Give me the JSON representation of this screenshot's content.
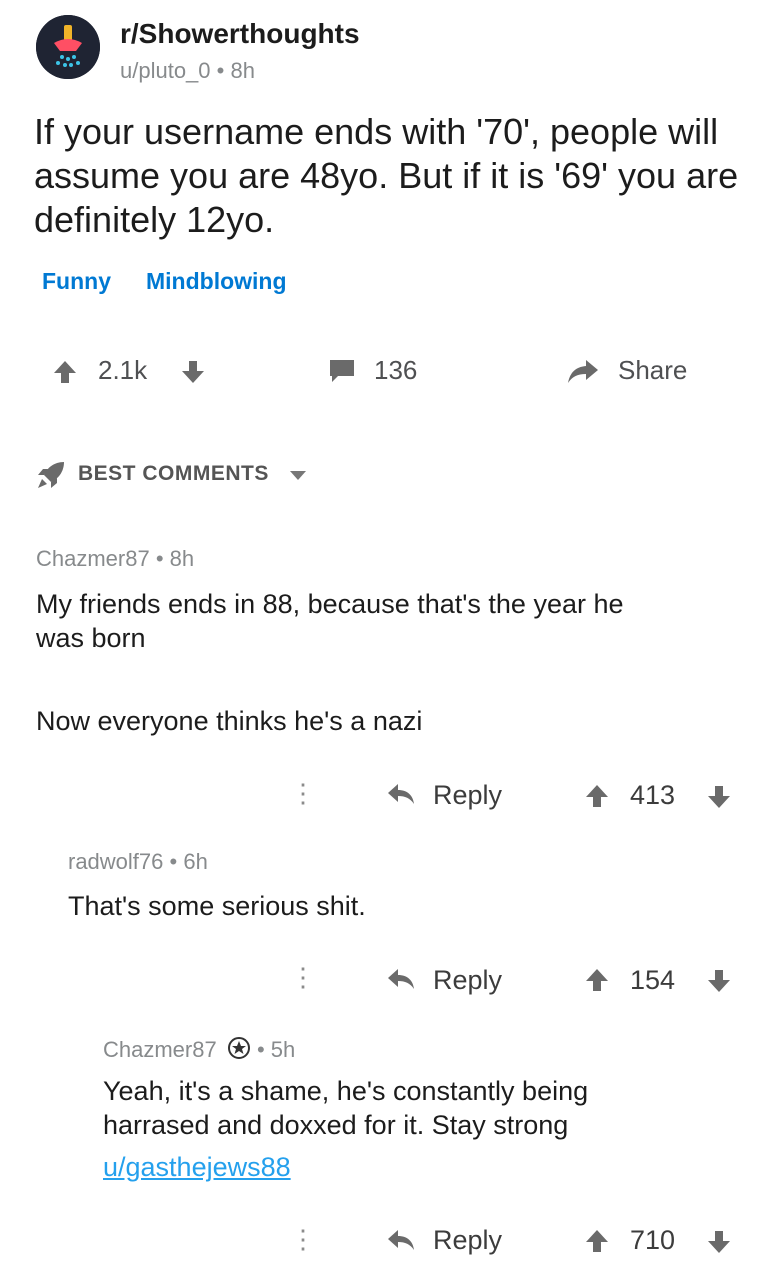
{
  "post": {
    "subreddit": "r/Showerthoughts",
    "author": "u/pluto_0",
    "separator": "•",
    "age": "8h",
    "title": "If your username ends with '70', people will assume you are 48yo. But if it is '69' you are definitely 12yo.",
    "flairs": [
      "Funny",
      "Mindblowing"
    ],
    "score": "2.1k",
    "comment_count": "136",
    "share_label": "Share"
  },
  "sort": {
    "label": "BEST COMMENTS"
  },
  "comments": [
    {
      "author": "Chazmer87",
      "age": "8h",
      "body_line1": "My friends ends in 88, because that's the year he was born",
      "body_line2": "Now everyone thinks he's a nazi",
      "reply_label": "Reply",
      "score": "413"
    },
    {
      "author": "radwolf76",
      "age": "6h",
      "body_line1": "That's some serious shit.",
      "reply_label": "Reply",
      "score": "154"
    },
    {
      "author": "Chazmer87",
      "age": "5h",
      "body_line1": "Yeah, it's a shame, he's constantly being harrased and doxxed for it.  Stay strong",
      "link": "u/gasthejews88",
      "reply_label": "Reply",
      "score": "710"
    }
  ],
  "colors": {
    "link_blue": "#24a0ed",
    "flair_blue": "#0079d3",
    "muted": "#878a8c",
    "avatar_bg": "#1f2433"
  },
  "icons": [
    "showerhead-icon",
    "upvote-icon",
    "downvote-icon",
    "comment-icon",
    "share-icon",
    "rocket-icon",
    "chevron-down-icon",
    "more-icon",
    "reply-icon",
    "flair-icon"
  ]
}
